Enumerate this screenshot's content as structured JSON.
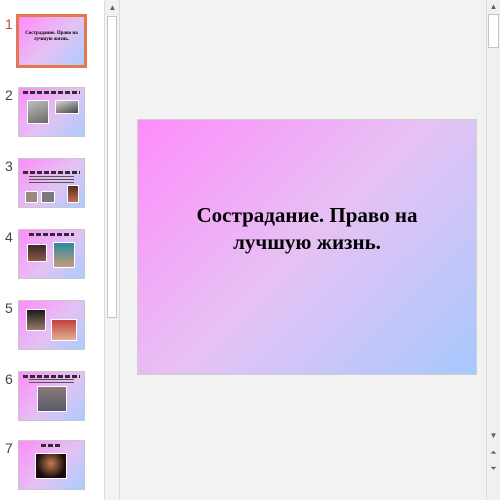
{
  "thumbnails": [
    {
      "number": "1",
      "title": "Сострадание. Право на лучшую жизнь.",
      "selected": true
    },
    {
      "number": "2"
    },
    {
      "number": "3"
    },
    {
      "number": "4"
    },
    {
      "number": "5"
    },
    {
      "number": "6"
    },
    {
      "number": "7"
    }
  ],
  "slide": {
    "title": "Сострадание. Право на лучшую жизнь."
  },
  "scrollbar": {
    "up_icon": "▲",
    "down_icon": "▼",
    "prev_slide_icon": "⏶",
    "next_slide_icon": "⏷"
  },
  "colors": {
    "selection_border": "#e3774d",
    "slide_gradient_start": "#fe8cfa",
    "slide_gradient_end": "#a7c9fe",
    "editor_background": "#f2f2f2"
  }
}
